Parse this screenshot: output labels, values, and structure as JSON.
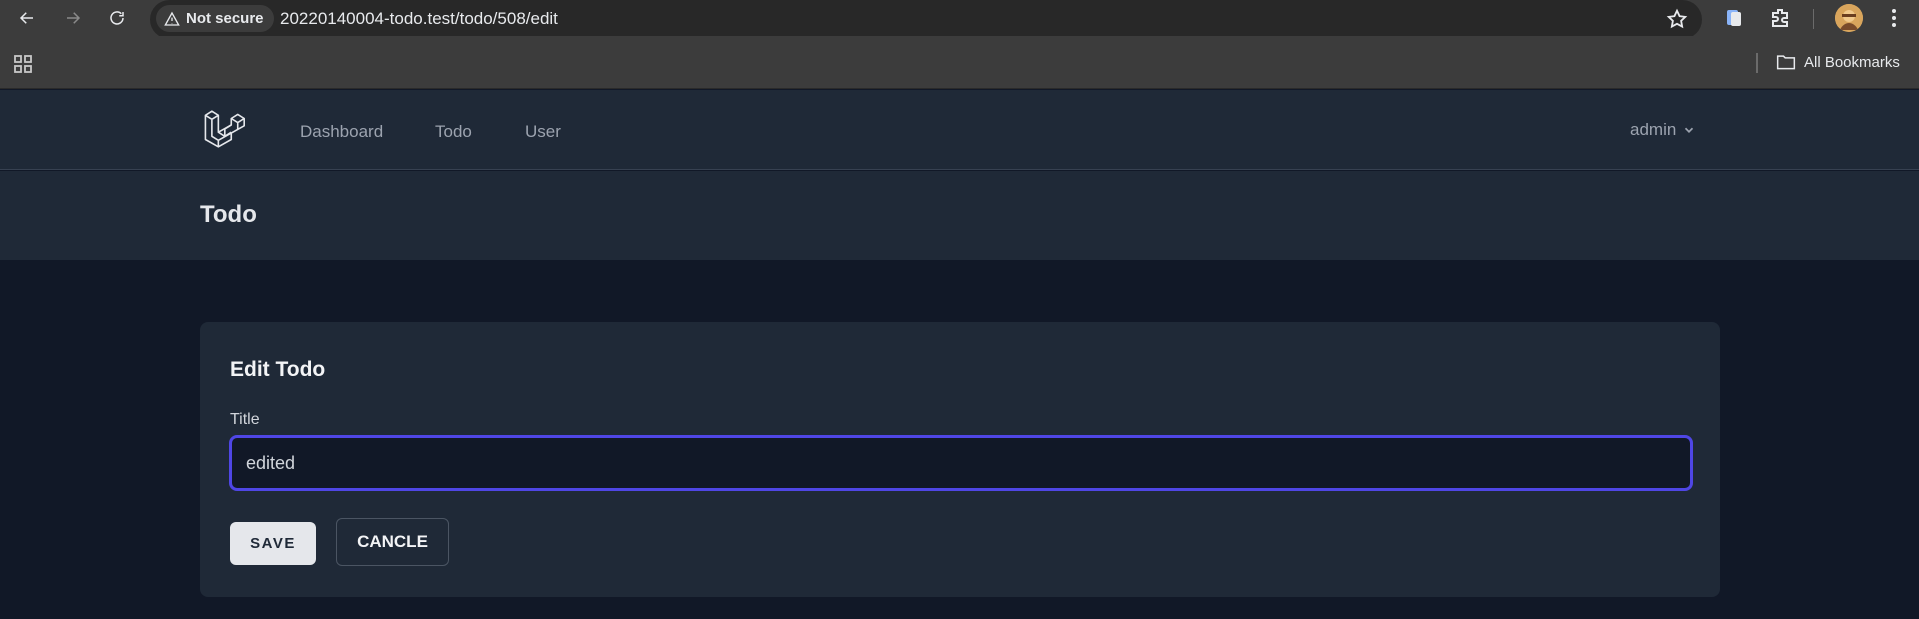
{
  "browser": {
    "security_label": "Not secure",
    "url": "20220140004-todo.test/todo/508/edit",
    "bookmarks_label": "All Bookmarks",
    "icons": [
      "back-icon",
      "forward-icon",
      "reload-icon",
      "warning-icon",
      "star-icon",
      "extension-icon",
      "puzzle-icon",
      "avatar",
      "more-icon",
      "apps-icon",
      "folder-icon"
    ]
  },
  "nav": {
    "links": [
      "Dashboard",
      "Todo",
      "User"
    ],
    "user": "admin"
  },
  "header": {
    "title": "Todo"
  },
  "form": {
    "heading": "Edit Todo",
    "title_label": "Title",
    "title_value": "edited",
    "save_label": "SAVE",
    "cancel_label": "CANCLE"
  },
  "colors": {
    "page_bg": "#111827",
    "panel_bg": "#1f2937",
    "focus_ring": "#4f46e5"
  }
}
